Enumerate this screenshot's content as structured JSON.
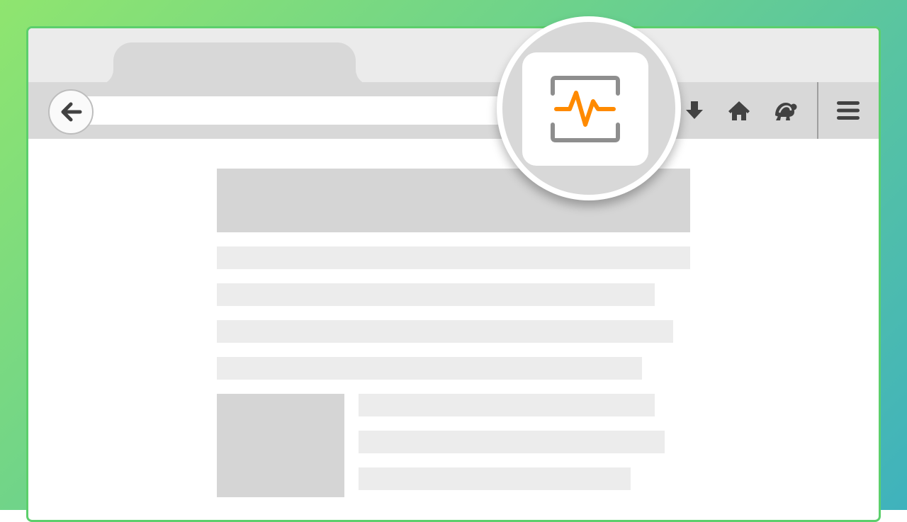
{
  "colors": {
    "accent": "#ff8a00",
    "icon_gray": "#8e8e8e",
    "toolbar_icon": "#424242",
    "window_border": "#5ccf6c"
  },
  "icons": {
    "back": "arrow-left-icon",
    "download": "download-arrow-icon",
    "home": "home-icon",
    "pocket": "turtle-icon",
    "menu": "hamburger-menu-icon",
    "highlight": "performance-pulse-icon"
  }
}
